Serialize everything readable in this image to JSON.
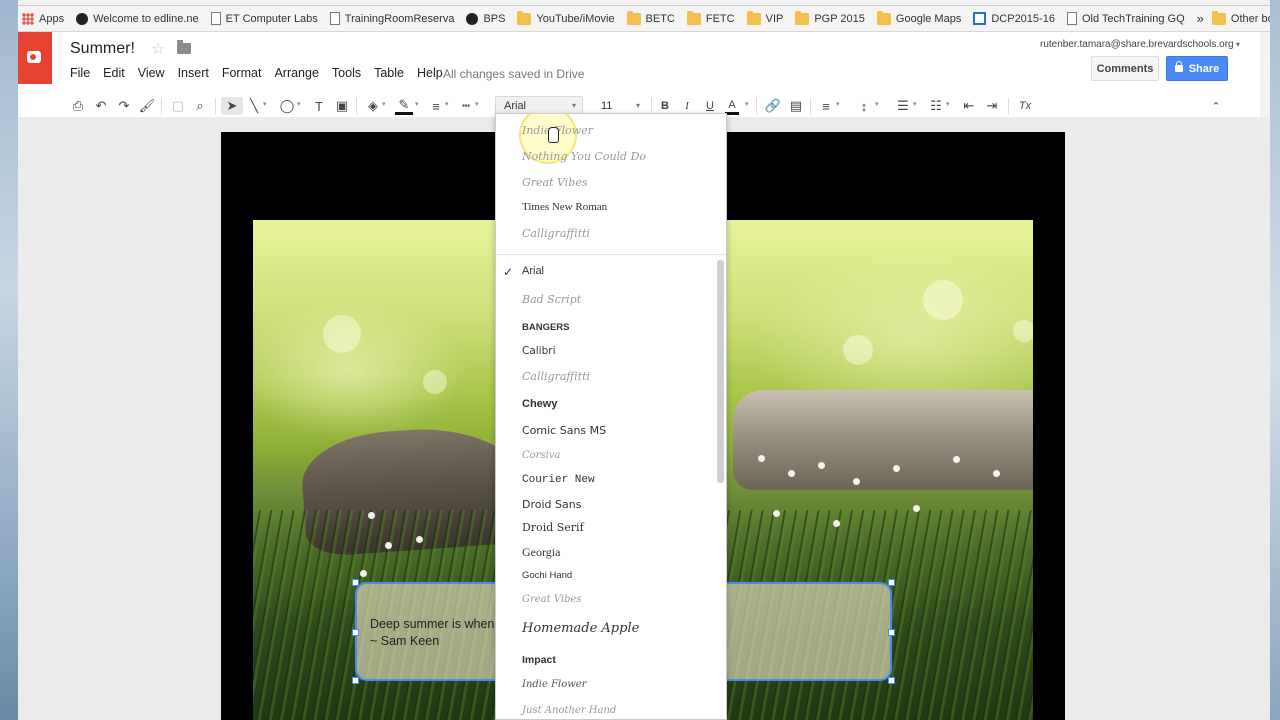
{
  "bookmarks": [
    {
      "label": "Apps",
      "icon": "apps"
    },
    {
      "label": "Welcome to edline.ne",
      "icon": "edline"
    },
    {
      "label": "ET Computer Labs",
      "icon": "page"
    },
    {
      "label": "TrainingRoomReserva",
      "icon": "page"
    },
    {
      "label": "BPS",
      "icon": "bps"
    },
    {
      "label": "YouTube/iMovie",
      "icon": "folder"
    },
    {
      "label": "BETC",
      "icon": "folder"
    },
    {
      "label": "FETC",
      "icon": "folder"
    },
    {
      "label": "VIP",
      "icon": "folder"
    },
    {
      "label": "PGP 2015",
      "icon": "folder"
    },
    {
      "label": "Google Maps",
      "icon": "folder"
    },
    {
      "label": "DCP2015-16",
      "icon": "blue"
    },
    {
      "label": "Old TechTraining GQ",
      "icon": "page"
    }
  ],
  "bookmarks_more": "»",
  "other_bookmarks": "Other bookmarks",
  "doc": {
    "title": "Summer!",
    "saved_status": "All changes saved in Drive",
    "user_email": "rutenber.tamara@share.brevardschools.org"
  },
  "menu": [
    "File",
    "Edit",
    "View",
    "Insert",
    "Format",
    "Arrange",
    "Tools",
    "Table",
    "Help"
  ],
  "buttons": {
    "comments": "Comments",
    "share": "Share"
  },
  "toolbar": {
    "font": "Arial",
    "size": "11",
    "bold": "B",
    "italic": "I",
    "underline": "U",
    "text_color": "A",
    "clear_format": "Tx"
  },
  "textbox": {
    "line1": "Deep summer is when",
    "line2": "~ Sam Keen"
  },
  "font_menu": {
    "recent": [
      "Indie Flower",
      "Nothing You Could Do",
      "Great Vibes",
      "Times New Roman",
      "Calligraffitti"
    ],
    "selected": "Arial",
    "all": [
      "Arial",
      "Bad Script",
      "Bangers",
      "Calibri",
      "Calligraffitti",
      "Chewy",
      "Comic Sans MS",
      "Corsiva",
      "Courier New",
      "Droid Sans",
      "Droid Serif",
      "Georgia",
      "Gochi Hand",
      "Great Vibes",
      "Homemade Apple",
      "Impact",
      "Indie Flower",
      "Just Another Hand"
    ]
  },
  "colors": {
    "accent_blue": "#4a8af4",
    "app_red": "#e84233",
    "folder_yellow": "#f3c14f"
  }
}
